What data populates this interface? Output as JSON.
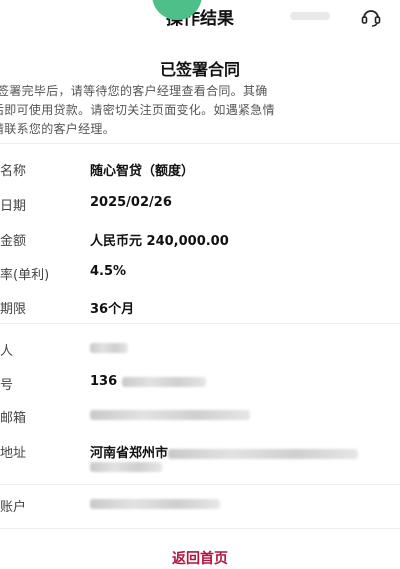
{
  "header": {
    "title": "操作结果",
    "support_icon": "headset-icon"
  },
  "status": {
    "icon": "success-circle-icon",
    "title": "已签署合同",
    "color": "#4dbf88"
  },
  "notice": {
    "lines": [
      "]签署完毕后，请等待您的客户经理查看合同。其确",
      "后即可使用贷款。请密切关注页面变化。如遇紧急情",
      "请联系您的客户经理。"
    ]
  },
  "loan_details": [
    {
      "label": "名称",
      "value": "随心智贷（额度）"
    },
    {
      "label": "日期",
      "value": "2025/02/26"
    },
    {
      "label": "金额",
      "value": "人民币元 240,000.00"
    },
    {
      "label": "率(单利)",
      "value": "4.5%"
    },
    {
      "label": "期限",
      "value": "36个月"
    }
  ],
  "personal_details": {
    "name_label": "人",
    "phone_label": "号",
    "phone_prefix": "136",
    "email_label": "邮箱",
    "address_label": "地址",
    "address_line1": "河南省郑州市",
    "account_label": "账户"
  },
  "footer": {
    "back_home_label": "返回首页",
    "accent_color": "#b2143d"
  }
}
